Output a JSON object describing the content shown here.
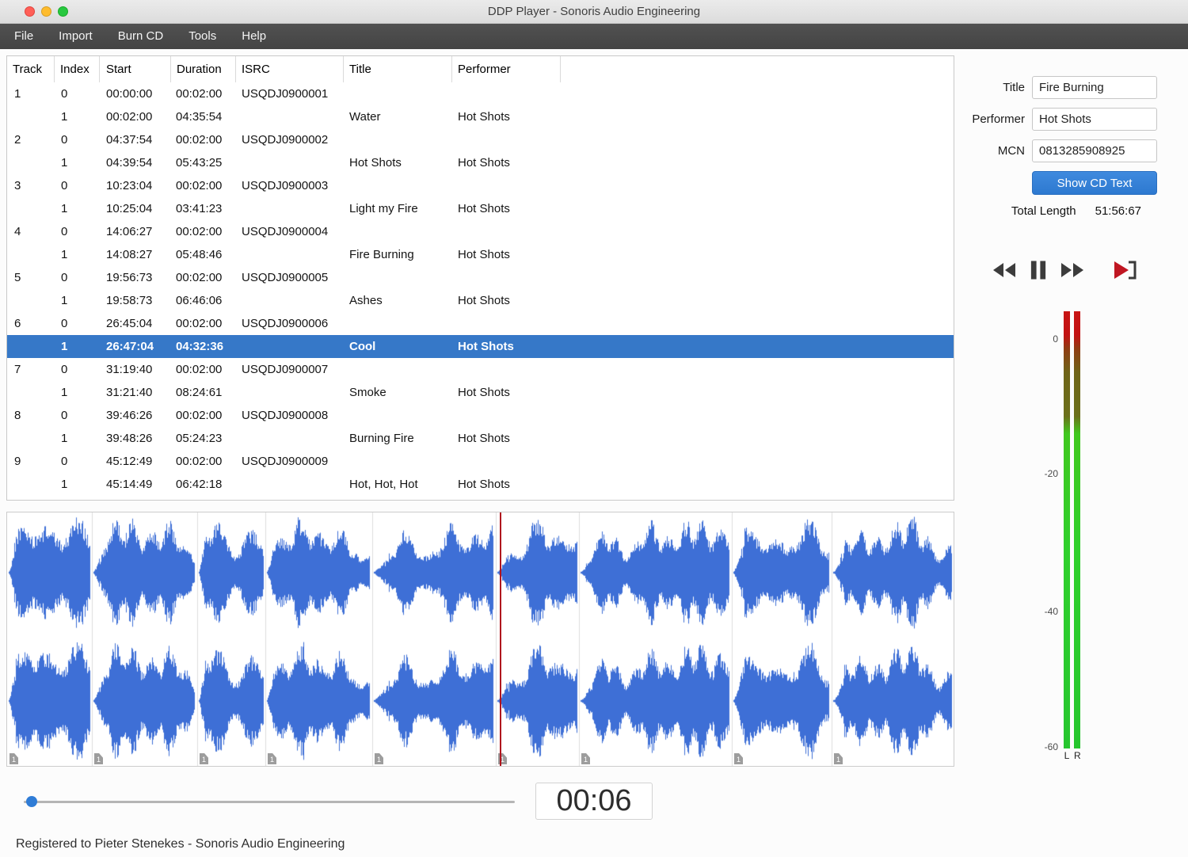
{
  "window": {
    "title": "DDP Player - Sonoris Audio Engineering",
    "status_text": "Registered to Pieter Stenekes - Sonoris Audio Engineering"
  },
  "menu": {
    "items": [
      "File",
      "Import",
      "Burn CD",
      "Tools",
      "Help"
    ]
  },
  "track_table": {
    "columns": [
      "Track",
      "Index",
      "Start",
      "Duration",
      "ISRC",
      "Title",
      "Performer"
    ],
    "rows": [
      {
        "track": "1",
        "index": "0",
        "start": "00:00:00",
        "duration": "00:02:00",
        "isrc": "USQDJ0900001",
        "title": "",
        "performer": ""
      },
      {
        "track": "",
        "index": "1",
        "start": "00:02:00",
        "duration": "04:35:54",
        "isrc": "",
        "title": "Water",
        "performer": "Hot Shots"
      },
      {
        "track": "2",
        "index": "0",
        "start": "04:37:54",
        "duration": "00:02:00",
        "isrc": "USQDJ0900002",
        "title": "",
        "performer": ""
      },
      {
        "track": "",
        "index": "1",
        "start": "04:39:54",
        "duration": "05:43:25",
        "isrc": "",
        "title": "Hot Shots",
        "performer": "Hot Shots"
      },
      {
        "track": "3",
        "index": "0",
        "start": "10:23:04",
        "duration": "00:02:00",
        "isrc": "USQDJ0900003",
        "title": "",
        "performer": ""
      },
      {
        "track": "",
        "index": "1",
        "start": "10:25:04",
        "duration": "03:41:23",
        "isrc": "",
        "title": "Light my Fire",
        "performer": "Hot Shots"
      },
      {
        "track": "4",
        "index": "0",
        "start": "14:06:27",
        "duration": "00:02:00",
        "isrc": "USQDJ0900004",
        "title": "",
        "performer": ""
      },
      {
        "track": "",
        "index": "1",
        "start": "14:08:27",
        "duration": "05:48:46",
        "isrc": "",
        "title": "Fire Burning",
        "performer": "Hot Shots"
      },
      {
        "track": "5",
        "index": "0",
        "start": "19:56:73",
        "duration": "00:02:00",
        "isrc": "USQDJ0900005",
        "title": "",
        "performer": ""
      },
      {
        "track": "",
        "index": "1",
        "start": "19:58:73",
        "duration": "06:46:06",
        "isrc": "",
        "title": "Ashes",
        "performer": "Hot Shots"
      },
      {
        "track": "6",
        "index": "0",
        "start": "26:45:04",
        "duration": "00:02:00",
        "isrc": "USQDJ0900006",
        "title": "",
        "performer": ""
      },
      {
        "track": "",
        "index": "1",
        "start": "26:47:04",
        "duration": "04:32:36",
        "isrc": "",
        "title": "Cool",
        "performer": "Hot Shots",
        "selected": true
      },
      {
        "track": "7",
        "index": "0",
        "start": "31:19:40",
        "duration": "00:02:00",
        "isrc": "USQDJ0900007",
        "title": "",
        "performer": ""
      },
      {
        "track": "",
        "index": "1",
        "start": "31:21:40",
        "duration": "08:24:61",
        "isrc": "",
        "title": "Smoke",
        "performer": "Hot Shots"
      },
      {
        "track": "8",
        "index": "0",
        "start": "39:46:26",
        "duration": "00:02:00",
        "isrc": "USQDJ0900008",
        "title": "",
        "performer": ""
      },
      {
        "track": "",
        "index": "1",
        "start": "39:48:26",
        "duration": "05:24:23",
        "isrc": "",
        "title": "Burning Fire",
        "performer": "Hot Shots"
      },
      {
        "track": "9",
        "index": "0",
        "start": "45:12:49",
        "duration": "00:02:00",
        "isrc": "USQDJ0900009",
        "title": "",
        "performer": ""
      },
      {
        "track": "",
        "index": "1",
        "start": "45:14:49",
        "duration": "06:42:18",
        "isrc": "",
        "title": "Hot, Hot, Hot",
        "performer": "Hot Shots"
      }
    ]
  },
  "editor": {
    "title_label": "Title",
    "title_value": "Fire Burning",
    "performer_label": "Performer",
    "performer_value": "Hot Shots",
    "mcn_label": "MCN",
    "mcn_value": "0813285908925",
    "show_cd_text_button": "Show CD Text",
    "total_length_label": "Total Length",
    "total_length_value": "51:56:67"
  },
  "transport": {
    "time_display": "00:06",
    "buttons": [
      "rewind",
      "pause",
      "fast-forward",
      "play-marker"
    ]
  },
  "meter": {
    "scale_labels": [
      "0",
      "-20",
      "-40",
      "-60"
    ],
    "channel_labels": [
      "L",
      "R"
    ]
  },
  "waveform": {
    "marker_label": "1",
    "color": "#3e6fd6",
    "playhead_color": "#b0141e",
    "playing_track_number": 6,
    "playhead_seconds": 6
  },
  "colors": {
    "accent_blue": "#2f7cd6",
    "selection_blue": "#3678c8"
  }
}
